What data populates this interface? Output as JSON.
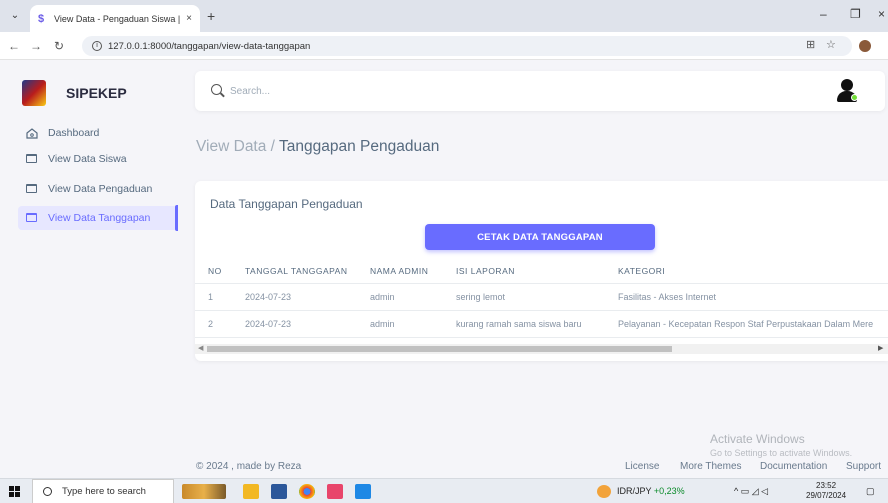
{
  "browser": {
    "tab_title": "View Data - Pengaduan Siswa |",
    "tab_close": "×",
    "new_tab": "+",
    "url": "127.0.0.1:8000/tanggapan/view-data-tanggapan",
    "win_min": "–",
    "win_max": "❐",
    "win_close": "×"
  },
  "sidebar": {
    "brand": "SIPEKEP",
    "items": [
      {
        "label": "Dashboard"
      },
      {
        "label": "View Data Siswa"
      },
      {
        "label": "View Data Pengaduan"
      },
      {
        "label": "View Data Tanggapan"
      }
    ]
  },
  "navbar": {
    "search_placeholder": "Search..."
  },
  "page": {
    "breadcrumb_parent": "View Data /",
    "breadcrumb_current": "Tanggapan Pengaduan"
  },
  "card": {
    "title": "Data Tanggapan Pengaduan",
    "print_button": "CETAK DATA TANGGAPAN",
    "columns": [
      "NO",
      "TANGGAL TANGGAPAN",
      "NAMA ADMIN",
      "ISI LAPORAN",
      "KATEGORI"
    ],
    "rows": [
      [
        "1",
        "2024-07-23",
        "admin",
        "sering lemot",
        "Fasilitas - Akses Internet"
      ],
      [
        "2",
        "2024-07-23",
        "admin",
        "kurang ramah sama siswa baru",
        "Pelayanan - Kecepatan Respon Staf Perpustakaan Dalam Mere"
      ]
    ]
  },
  "footer": {
    "copyright": "© 2024 , made by Reza",
    "links": [
      "License",
      "More Themes",
      "Documentation",
      "Support"
    ]
  },
  "watermark": {
    "line1": "Activate Windows",
    "line2": "Go to Settings to activate Windows."
  },
  "taskbar": {
    "search_placeholder": "Type here to search",
    "ticker_pair": "IDR/JPY",
    "ticker_change": "+0,23%",
    "time": "23:52",
    "date": "29/07/2024"
  },
  "colors": {
    "accent": "#696cff",
    "active_bg": "#e7e7ff",
    "online": "#71dd37"
  }
}
